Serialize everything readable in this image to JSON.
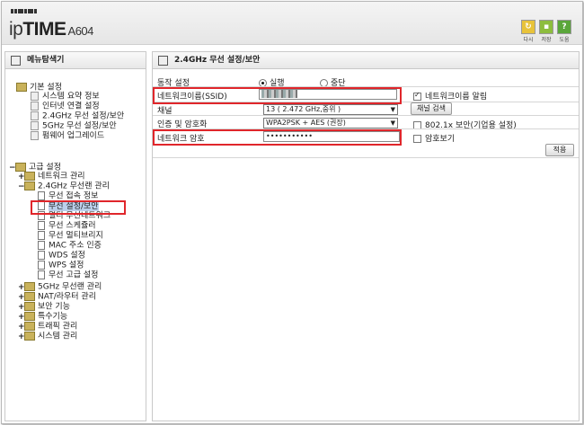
{
  "header": {
    "brand_ip": "ip",
    "brand_time": "TIME",
    "model": "A604",
    "buttons": [
      {
        "label": "다시",
        "color": "#e8c33a",
        "icon": "refresh-icon"
      },
      {
        "label": "저장",
        "color": "#8dbd3e",
        "icon": "save-icon"
      },
      {
        "label": "도움",
        "color": "#5aa63a",
        "icon": "help-icon",
        "glyph": "?"
      }
    ]
  },
  "sidebar": {
    "title": "메뉴탐색기",
    "basic": {
      "label": "기본 설정",
      "items": [
        "시스템 요약 정보",
        "인터넷 연결 설정",
        "2.4GHz 무선 설정/보안",
        "5GHz 무선 설정/보안",
        "펌웨어 업그레이드"
      ]
    },
    "advanced": {
      "label": "고급 설정",
      "network": "네트워크 관리",
      "wifi24": "2.4GHz 무선랜 관리",
      "wifi24_items": [
        "무선 접속 정보",
        "무선 설정/보안",
        "멀티 무선네트워크",
        "무선 스케쥴러",
        "무선 멀티브리지",
        "MAC 주소 인증",
        "WDS 설정",
        "WPS 설정",
        "무선 고급 설정"
      ],
      "others": [
        "5GHz 무선랜 관리",
        "NAT/라우터 관리",
        "보안 기능",
        "특수기능",
        "트래픽 관리",
        "시스템 관리"
      ]
    }
  },
  "content": {
    "title": "2.4GHz 무선 설정/보안",
    "status_label": "동작 설정",
    "radio_on": "실행",
    "radio_off": "중단",
    "ssid_label": "네트워크이름(SSID)",
    "broadcast_label": "네트워크이름 알림",
    "channel_label": "채널",
    "channel_value": "13 ( 2.472 GHz,중위 )",
    "channel_search": "채널 검색",
    "auth_label": "인증 및 암호화",
    "auth_value": "WPA2PSK + AES (권장)",
    "enterprise_label": "802.1x 보안(기업용 설정)",
    "password_label": "네트워크 암호",
    "password_value": "•••••••••••",
    "show_password": "암호보기",
    "apply": "적용"
  },
  "colors": {
    "highlight": "#e0262b",
    "selected": "#bcd0ec"
  }
}
